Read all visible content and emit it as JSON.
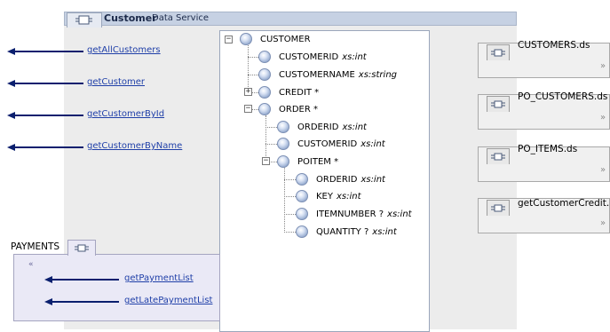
{
  "service": {
    "name": "Customer",
    "subtitle": "Data Service",
    "tab_icon": "data-service-icon"
  },
  "operations": [
    {
      "label": "getAllCustomers"
    },
    {
      "label": "getCustomer"
    },
    {
      "label": "getCustomerById"
    },
    {
      "label": "getCustomerByName"
    }
  ],
  "schema_tree": {
    "root": {
      "name": "CUSTOMER",
      "expander": "−"
    },
    "nodes": [
      {
        "name": "CUSTOMERID",
        "type": "xs:int"
      },
      {
        "name": "CUSTOMERNAME",
        "type": "xs:string"
      },
      {
        "name": "CREDIT *",
        "type": "",
        "expander": "+"
      },
      {
        "name": "ORDER *",
        "type": "",
        "expander": "−"
      },
      {
        "name": "ORDERID",
        "type": "xs:int"
      },
      {
        "name": "CUSTOMERID",
        "type": "xs:int"
      },
      {
        "name": "POITEM *",
        "type": "",
        "expander": "−"
      },
      {
        "name": "ORDERID",
        "type": "xs:int"
      },
      {
        "name": "KEY",
        "type": "xs:int"
      },
      {
        "name": "ITEMNUMBER ?",
        "type": "xs:int"
      },
      {
        "name": "QUANTITY ?",
        "type": "xs:int"
      }
    ]
  },
  "data_sources": [
    {
      "label": "CUSTOMERS.ds",
      "chevron": "»"
    },
    {
      "label": "PO_CUSTOMERS.ds",
      "chevron": "»"
    },
    {
      "label": "PO_ITEMS.ds",
      "chevron": "»"
    },
    {
      "label": "getCustomerCredit.",
      "chevron": "»"
    }
  ],
  "payments": {
    "label": "PAYMENTS",
    "collapse_glyph": "«",
    "operations": [
      {
        "label": "getPaymentList"
      },
      {
        "label": "getLatePaymentList"
      }
    ]
  },
  "colors": {
    "arrow": "#0a1f6e",
    "link": "#1f3fa8",
    "header_bg": "#c6d1e3",
    "payments_bg": "#eae9f6"
  }
}
